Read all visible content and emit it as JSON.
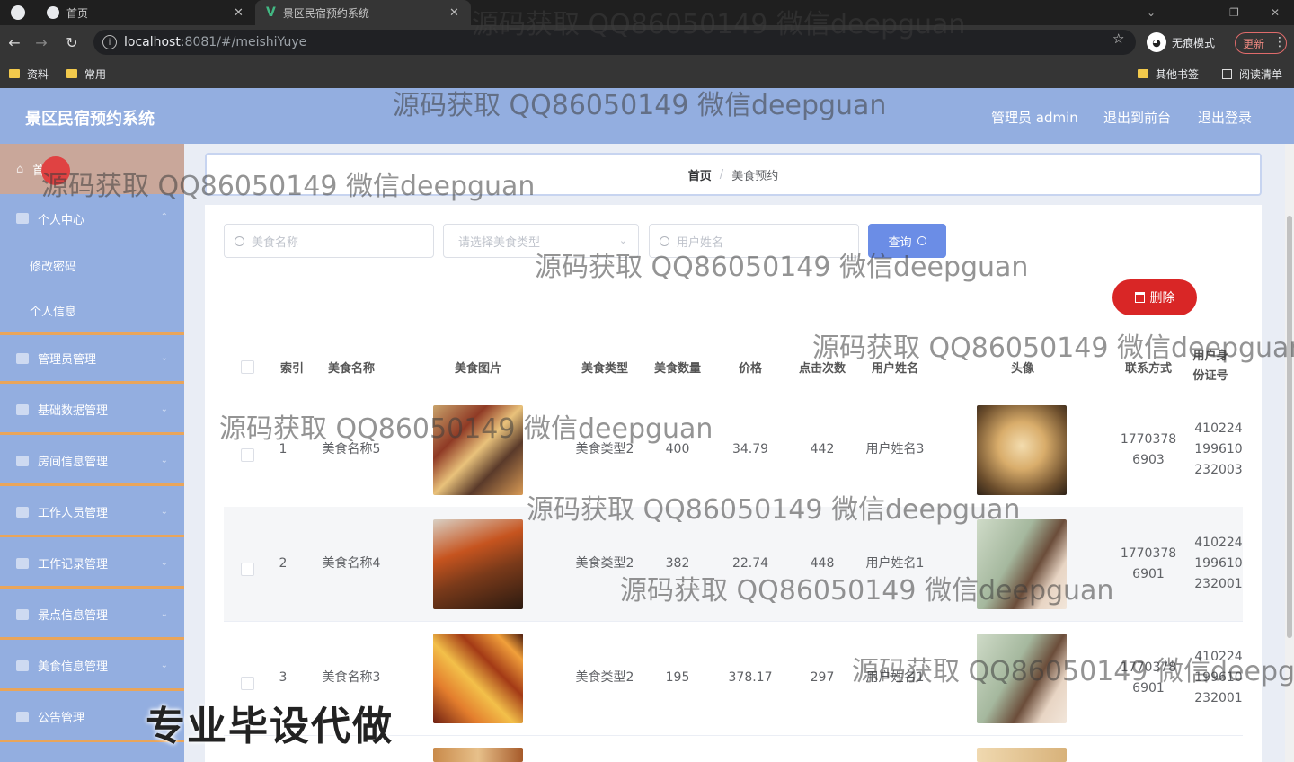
{
  "browser": {
    "tabs": [
      {
        "title": "首页",
        "active": false
      },
      {
        "title": "景区民宿预约系统",
        "active": true
      }
    ],
    "url_host": "localhost",
    "url_path": ":8081/#/meishiYuye",
    "incognito_label": "无痕模式",
    "update_label": "更新",
    "bookmarks": [
      "资料",
      "常用"
    ],
    "bookmarks_right": [
      "其他书签",
      "阅读清单"
    ]
  },
  "header": {
    "title": "景区民宿预约系统",
    "admin_label": "管理员 admin",
    "to_front": "退出到前台",
    "logout": "退出登录"
  },
  "sidebar": {
    "home": "首页",
    "personal": "个人中心",
    "subitems": [
      "修改密码",
      "个人信息"
    ],
    "items": [
      "管理员管理",
      "基础数据管理",
      "房间信息管理",
      "工作人员管理",
      "工作记录管理",
      "景点信息管理",
      "美食信息管理",
      "公告管理"
    ]
  },
  "breadcrumb": {
    "home": "首页",
    "current": "美食预约"
  },
  "search": {
    "food_name_placeholder": "美食名称",
    "food_type_placeholder": "请选择美食类型",
    "user_name_placeholder": "用户姓名",
    "query_label": "查询"
  },
  "actions": {
    "delete_label": "删除"
  },
  "table": {
    "headers": [
      "索引",
      "美食名称",
      "美食图片",
      "美食类型",
      "美食数量",
      "价格",
      "点击次数",
      "用户姓名",
      "头像",
      "联系方式",
      "用户身份证号"
    ],
    "rows": [
      {
        "index": "1",
        "name": "美食名称5",
        "type": "美食类型2",
        "qty": "400",
        "price": "34.79",
        "clicks": "442",
        "user": "用户姓名3",
        "phone": "17703786903",
        "id_no": "410224199610232003"
      },
      {
        "index": "2",
        "name": "美食名称4",
        "type": "美食类型2",
        "qty": "382",
        "price": "22.74",
        "clicks": "448",
        "user": "用户姓名1",
        "phone": "17703786901",
        "id_no": "410224199610232001"
      },
      {
        "index": "3",
        "name": "美食名称3",
        "type": "美食类型2",
        "qty": "195",
        "price": "378.17",
        "clicks": "297",
        "user": "用户姓名1",
        "phone": "17703786901",
        "id_no": "410224199610232001"
      }
    ]
  },
  "watermark": "源码获取 QQ86050149 微信deepguan",
  "promo_text": "专业毕设代做",
  "colors": {
    "header_bg": "#93aee0",
    "sidebar_bg": "#93aee0",
    "divider": "#e9a55a",
    "query_btn": "#6b8de6",
    "delete_btn": "#d92626"
  }
}
